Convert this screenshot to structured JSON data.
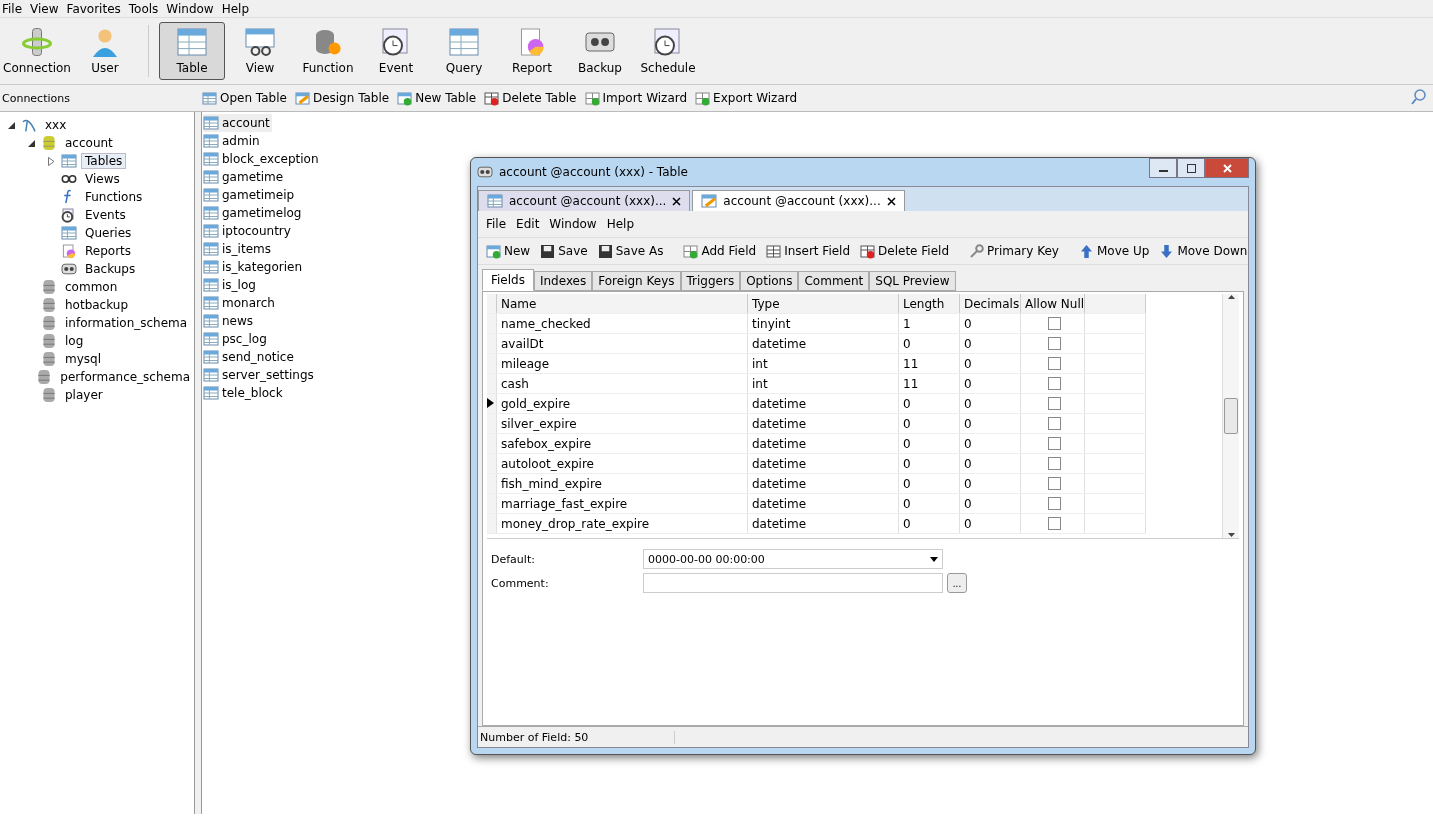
{
  "menu": [
    "File",
    "View",
    "Favorites",
    "Tools",
    "Window",
    "Help"
  ],
  "toolbar": [
    {
      "label": "Connection",
      "selected": false,
      "kind": "plug"
    },
    {
      "label": "User",
      "selected": false,
      "kind": "user"
    },
    {
      "label": "Table",
      "selected": true,
      "kind": "table"
    },
    {
      "label": "View",
      "selected": false,
      "kind": "view"
    },
    {
      "label": "Function",
      "selected": false,
      "kind": "function"
    },
    {
      "label": "Event",
      "selected": false,
      "kind": "clock"
    },
    {
      "label": "Query",
      "selected": false,
      "kind": "table"
    },
    {
      "label": "Report",
      "selected": false,
      "kind": "report"
    },
    {
      "label": "Backup",
      "selected": false,
      "kind": "tape"
    },
    {
      "label": "Schedule",
      "selected": false,
      "kind": "clock"
    }
  ],
  "connections_label": "Connections",
  "object_toolbar": [
    "Open Table",
    "Design Table",
    "New Table",
    "Delete Table",
    "Import Wizard",
    "Export Wizard"
  ],
  "tree": [
    {
      "label": "xxx",
      "kind": "server",
      "expanded": true,
      "children": [
        {
          "label": "account",
          "kind": "db-open",
          "expanded": true,
          "children": [
            {
              "label": "Tables",
              "kind": "table",
              "selected": true
            },
            {
              "label": "Views",
              "kind": "glasses",
              "selected": false
            },
            {
              "label": "Functions",
              "kind": "fx",
              "selected": false
            },
            {
              "label": "Events",
              "kind": "clock",
              "selected": false
            },
            {
              "label": "Queries",
              "kind": "table",
              "selected": false
            },
            {
              "label": "Reports",
              "kind": "report",
              "selected": false
            },
            {
              "label": "Backups",
              "kind": "tape",
              "selected": false
            }
          ]
        },
        {
          "label": "common",
          "kind": "db"
        },
        {
          "label": "hotbackup",
          "kind": "db"
        },
        {
          "label": "information_schema",
          "kind": "db"
        },
        {
          "label": "log",
          "kind": "db"
        },
        {
          "label": "mysql",
          "kind": "db"
        },
        {
          "label": "performance_schema",
          "kind": "db"
        },
        {
          "label": "player",
          "kind": "db"
        }
      ]
    }
  ],
  "tables": [
    {
      "name": "account",
      "selected": true
    },
    {
      "name": "admin",
      "selected": false
    },
    {
      "name": "block_exception",
      "selected": false
    },
    {
      "name": "gametime",
      "selected": false
    },
    {
      "name": "gametimeip",
      "selected": false
    },
    {
      "name": "gametimelog",
      "selected": false
    },
    {
      "name": "iptocountry",
      "selected": false
    },
    {
      "name": "is_items",
      "selected": false
    },
    {
      "name": "is_kategorien",
      "selected": false
    },
    {
      "name": "is_log",
      "selected": false
    },
    {
      "name": "monarch",
      "selected": false
    },
    {
      "name": "news",
      "selected": false
    },
    {
      "name": "psc_log",
      "selected": false
    },
    {
      "name": "send_notice",
      "selected": false
    },
    {
      "name": "server_settings",
      "selected": false
    },
    {
      "name": "tele_block",
      "selected": false
    }
  ],
  "editor_window": {
    "title": "account @account (xxx) - Table",
    "tabs": [
      {
        "label": "account @account (xxx)...",
        "selected": false,
        "kind": "table"
      },
      {
        "label": "account @account (xxx)...",
        "selected": true,
        "kind": "design"
      }
    ],
    "menu": [
      "File",
      "Edit",
      "Window",
      "Help"
    ],
    "toolbar": [
      {
        "label": "New",
        "kind": "new"
      },
      {
        "label": "Save",
        "kind": "save"
      },
      {
        "label": "Save As",
        "kind": "save"
      },
      {
        "label": "Add Field",
        "kind": "add"
      },
      {
        "label": "Insert Field",
        "kind": "grid"
      },
      {
        "label": "Delete Field",
        "kind": "delete"
      },
      {
        "label": "Primary Key",
        "kind": "key"
      },
      {
        "label": "Move Up",
        "kind": "up"
      },
      {
        "label": "Move Down",
        "kind": "down"
      }
    ],
    "subtabs": [
      {
        "label": "Fields",
        "selected": true
      },
      {
        "label": "Indexes",
        "selected": false
      },
      {
        "label": "Foreign Keys",
        "selected": false
      },
      {
        "label": "Triggers",
        "selected": false
      },
      {
        "label": "Options",
        "selected": false
      },
      {
        "label": "Comment",
        "selected": false
      },
      {
        "label": "SQL Preview",
        "selected": false
      }
    ],
    "columns": [
      "Name",
      "Type",
      "Length",
      "Decimals",
      "Allow Null"
    ],
    "rows": [
      {
        "name": "name_checked",
        "type": "tinyint",
        "length": "1",
        "decimals": "0",
        "allow_null": false,
        "current": false
      },
      {
        "name": "availDt",
        "type": "datetime",
        "length": "0",
        "decimals": "0",
        "allow_null": false,
        "current": false
      },
      {
        "name": "mileage",
        "type": "int",
        "length": "11",
        "decimals": "0",
        "allow_null": false,
        "current": false
      },
      {
        "name": "cash",
        "type": "int",
        "length": "11",
        "decimals": "0",
        "allow_null": false,
        "current": false
      },
      {
        "name": "gold_expire",
        "type": "datetime",
        "length": "0",
        "decimals": "0",
        "allow_null": false,
        "current": true
      },
      {
        "name": "silver_expire",
        "type": "datetime",
        "length": "0",
        "decimals": "0",
        "allow_null": false,
        "current": false
      },
      {
        "name": "safebox_expire",
        "type": "datetime",
        "length": "0",
        "decimals": "0",
        "allow_null": false,
        "current": false
      },
      {
        "name": "autoloot_expire",
        "type": "datetime",
        "length": "0",
        "decimals": "0",
        "allow_null": false,
        "current": false
      },
      {
        "name": "fish_mind_expire",
        "type": "datetime",
        "length": "0",
        "decimals": "0",
        "allow_null": false,
        "current": false
      },
      {
        "name": "marriage_fast_expire",
        "type": "datetime",
        "length": "0",
        "decimals": "0",
        "allow_null": false,
        "current": false
      },
      {
        "name": "money_drop_rate_expire",
        "type": "datetime",
        "length": "0",
        "decimals": "0",
        "allow_null": false,
        "current": false
      }
    ],
    "default_label": "Default:",
    "default_value": "0000-00-00 00:00:00",
    "comment_label": "Comment:",
    "comment_button": "...",
    "status": "Number of Field: 50"
  }
}
